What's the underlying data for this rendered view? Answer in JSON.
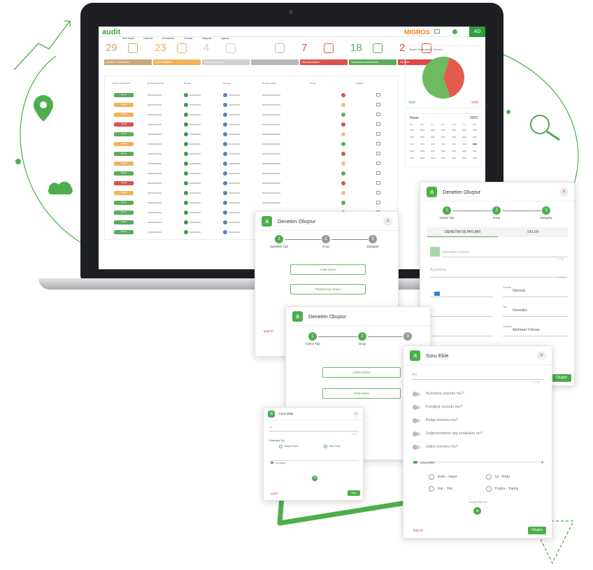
{
  "app": {
    "logo": "audit",
    "brand": "MIGROS",
    "user": "AD",
    "nav": [
      "Ana Sayfa",
      "Görevler",
      "Denetimler",
      "Formlar",
      "Raporlar",
      "Ayarlar"
    ]
  },
  "stats": [
    {
      "num": "29",
      "label": "Bekleyen Denetimler",
      "color": "#c9a777"
    },
    {
      "num": "23",
      "label": "Açık Denetimler",
      "color": "#f1b25b"
    },
    {
      "num": "4",
      "label": "Onay Denetimleri",
      "color": "#cfcfcf"
    },
    {
      "num": "",
      "label": "",
      "color": "#b9b9b9"
    },
    {
      "num": "7",
      "label": "Red Denetimler",
      "color": "#d9534f"
    },
    {
      "num": "18",
      "label": "Tamamlanan Denetimler",
      "color": "#5aab5a"
    },
    {
      "num": "2",
      "label": "Sorunlar",
      "color": "#e0454a"
    }
  ],
  "pie": {
    "title": "Bugün Tamamlanan Görevler",
    "green_label": "%60",
    "red_label": "%40",
    "green": 60,
    "red": 40
  },
  "calendar": {
    "month": "Nisan",
    "year": "2020",
    "days": [
      "Pzt",
      "Sal",
      "Çrş",
      "Per",
      "Cum",
      "Cmt",
      "Paz"
    ]
  },
  "table": {
    "headers": [
      "Durum / Bitiş Tarihi",
      "Denetlenecek Yer",
      "Denetçi",
      "Sorumlu",
      "Denetim Tarihi",
      "Durum",
      "Fotoğraf"
    ],
    "statuses": [
      "Tamam",
      "Başladı",
      "Başladı",
      "Gecikti",
      "Tamam",
      "Başladı",
      "Tamam",
      "Başladı",
      "Tamam",
      "Gecikti",
      "Başladı",
      "Tamam",
      "Tamam",
      "Tamam",
      "Tamam"
    ]
  },
  "modal1": {
    "title": "Denetim Oluştur",
    "steps": [
      "Denetim Tipi",
      "Grup",
      "Detaylar"
    ],
    "btn1": "Anlık Görev",
    "btn2": "Planlanmış Görev",
    "cancel": "İptal Et"
  },
  "modal2": {
    "title": "Denetim Oluştur",
    "steps": [
      "Görev Tipi",
      "Grup",
      "Detaylar"
    ],
    "btn1": "Çoklu Görev",
    "btn2": "Tekli Görev"
  },
  "modal3": {
    "title": "Denetim Oluştur",
    "steps": [
      "Görev Tipi",
      "Grup",
      "Detaylar"
    ],
    "tabs": [
      "DENETİM DETAYLARI",
      "EKLER"
    ],
    "name_placeholder": "Denetim Formu",
    "counter1": "0 / 50",
    "desc": "Açıklama",
    "counter2": "0 / 250",
    "priority_label": "Öncelik",
    "priority": "Normal",
    "type_label": "Tipi",
    "type": "Denetim",
    "person_label": "Yönetici",
    "person": "Mehmet Yılmaz",
    "submit": "Oluştur"
  },
  "modal4": {
    "title": "Soru Ekle",
    "name_label": "Ad",
    "counter": "0 / 50",
    "toggles": [
      "Açıklama zorunlu mu?",
      "Fotoğraf zorunlu mu?",
      "Belge zorunlu mu?",
      "Değerlendirme dışı bırakılsın mı?",
      "Video zorunlu mu?"
    ],
    "options_label": "Seçenekler",
    "options": [
      "Evet - Hayır",
      "İyi - Kötü",
      "Var - Yok",
      "Doğru - Yanlış"
    ],
    "add_hint": "Bu görünümü ekle",
    "cancel": "İptal Et",
    "submit": "Oluştur"
  },
  "modal5": {
    "title": "Form Ekle",
    "field": "Ad",
    "counter": "0 / 50",
    "type_label": "Puanlama Tipi",
    "opt1": "Başarı Puanı",
    "opt2": "Risk Puanı",
    "section": "Ana Başlık",
    "cancel": "İptal Et",
    "submit": "Ekle"
  },
  "colors": {
    "accent": "#4cae4c",
    "red": "#d9534f"
  }
}
